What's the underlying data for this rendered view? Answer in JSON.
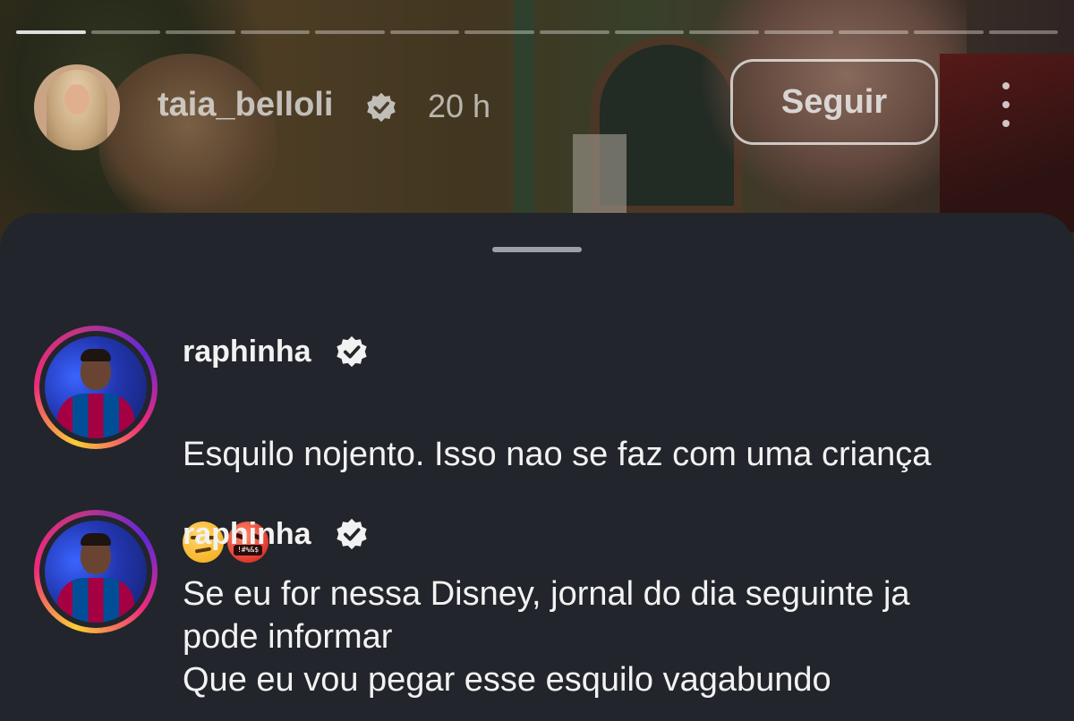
{
  "story": {
    "progress_segments": 14,
    "progress_completed": 1,
    "username": "taia_belloli",
    "verified": true,
    "time": "20 h",
    "follow_label": "Seguir",
    "more_icon": "more-vertical-icon"
  },
  "comments": [
    {
      "username": "raphinha",
      "verified": true,
      "text": "Esquilo nojento. Isso nao se faz com uma criança",
      "emojis": [
        "unamused-face",
        "face-with-symbols-on-mouth"
      ],
      "cursing_symbols": "!#%&$"
    },
    {
      "username": "raphinha",
      "verified": true,
      "text": "Se eu for nessa Disney, jornal do dia seguinte ja\npode informar\nQue eu vou pegar esse esquilo vagabundo"
    }
  ],
  "colors": {
    "sheet_bg": "#22252b",
    "text": "#f2f2f2",
    "verified_badge": "#f2f2f2"
  }
}
